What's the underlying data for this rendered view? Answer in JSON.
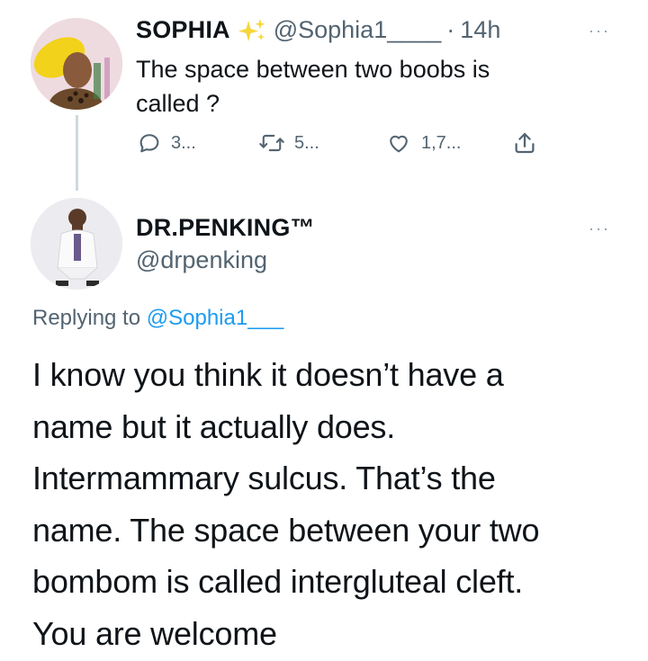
{
  "parent_tweet": {
    "name": "SOPHIA",
    "name_icon": "sparkles-icon",
    "handle": "@Sophia1____",
    "separator": "·",
    "time": "14h",
    "text_line1": "The space between two boobs is",
    "text_line2": "called ?",
    "actions": {
      "reply_count": "3...",
      "retweet_count": "5...",
      "like_count": "1,7...",
      "reply_icon": "reply-icon",
      "retweet_icon": "retweet-icon",
      "like_icon": "heart-icon",
      "share_icon": "share-icon"
    },
    "more": "···"
  },
  "reply_tweet": {
    "name": "DR.PENKING™",
    "handle": "@drpenking",
    "more": "···",
    "replying_prefix": "Replying to",
    "replying_mention": "@Sophia1___",
    "lines": [
      "I know you think it doesn’t have a",
      "name but it actually does.",
      "Intermammary sulcus. That’s the",
      "name. The space between your two",
      "bombom is called intergluteal cleft.",
      "You are welcome"
    ]
  },
  "colors": {
    "text": "#0f1419",
    "secondary": "#536471",
    "link": "#1d9bf0",
    "thread_line": "#cfd9de",
    "sparkle": "#f5c518"
  }
}
